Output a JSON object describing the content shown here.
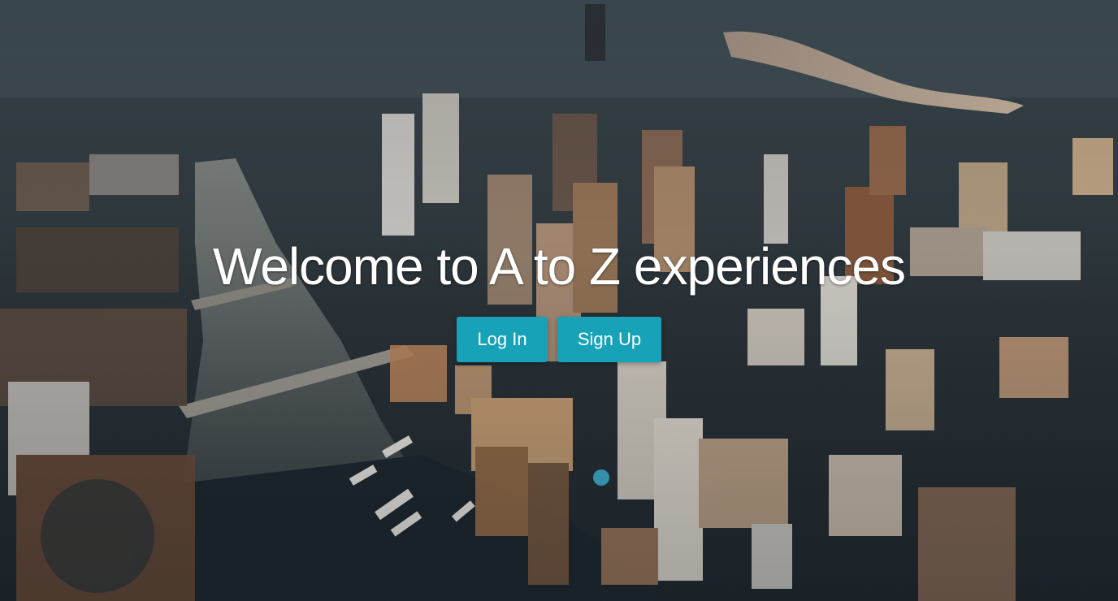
{
  "hero": {
    "title": "Welcome to A to Z experiences",
    "background_description_icon": "city-aerial-photo",
    "accent_color": "#17a2b8"
  },
  "actions": {
    "login_label": "Log In",
    "signup_label": "Sign Up"
  }
}
